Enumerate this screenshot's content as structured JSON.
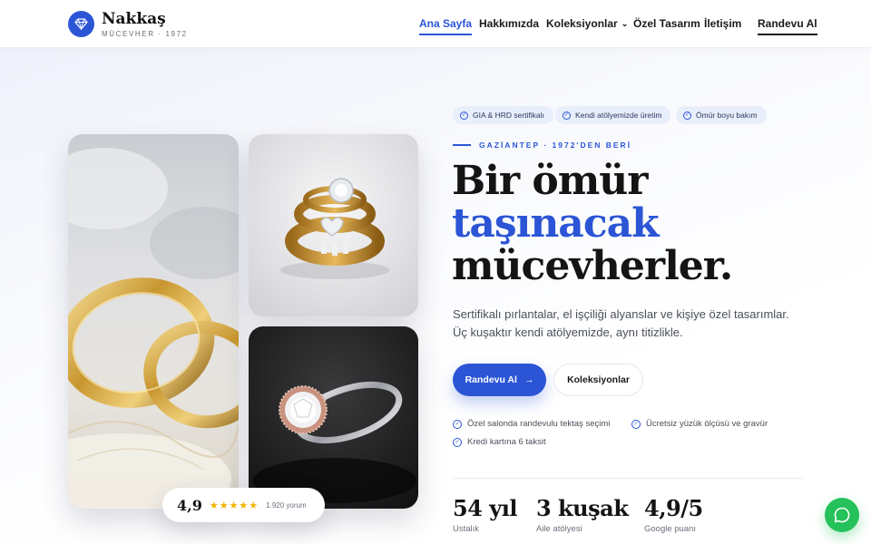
{
  "brand": {
    "name": "Nakkaş",
    "tagline": "MÜCEVHER · 1972",
    "logo_icon": "diamond-icon",
    "accent": "#2c55d6"
  },
  "nav": {
    "items": [
      {
        "label": "Ana Sayfa",
        "active": true
      },
      {
        "label": "Hakkımızda"
      },
      {
        "label": "Koleksiyonlar",
        "icon": "chevron-down-icon"
      },
      {
        "label": "Özel Tasarım"
      },
      {
        "label": "İletişim"
      }
    ],
    "cta": "Randevu Al"
  },
  "badges": [
    "GIA & HRD sertifikalı",
    "Kendi atölyemizde üretim",
    "Ömür boyu bakım"
  ],
  "eyebrow": "GAZİANTEP · 1972'DEN BERİ",
  "headline": {
    "line1": "Bir ömür",
    "line2": "taşınacak",
    "line3": "mücevherler."
  },
  "lead": "Sertifikalı pırlantalar, el işçiliği alyanslar ve kişiye özel tasarımlar. Üç kuşaktır kendi atölyemizde, aynı titizlikle.",
  "buttons": {
    "primary": "Randevu Al",
    "primary_icon": "arrow-right-icon",
    "secondary": "Koleksiyonlar"
  },
  "features": [
    "Özel salonda randevulu tektaş seçimi",
    "Ücretsiz yüzük ölçüsü ve gravür",
    "Kredi kartına 6 taksit"
  ],
  "stats": [
    {
      "value": "54 yıl",
      "label": "Ustalık"
    },
    {
      "value": "3 kuşak",
      "label": "Aile atölyesi"
    },
    {
      "value": "4,9/5",
      "label": "Google puanı"
    }
  ],
  "rating": {
    "score": "4,9",
    "stars": 5,
    "count": "1.920 yorum",
    "star_color": "#f2b400"
  },
  "chat": {
    "icon": "whatsapp-icon",
    "color": "#25c15a"
  }
}
